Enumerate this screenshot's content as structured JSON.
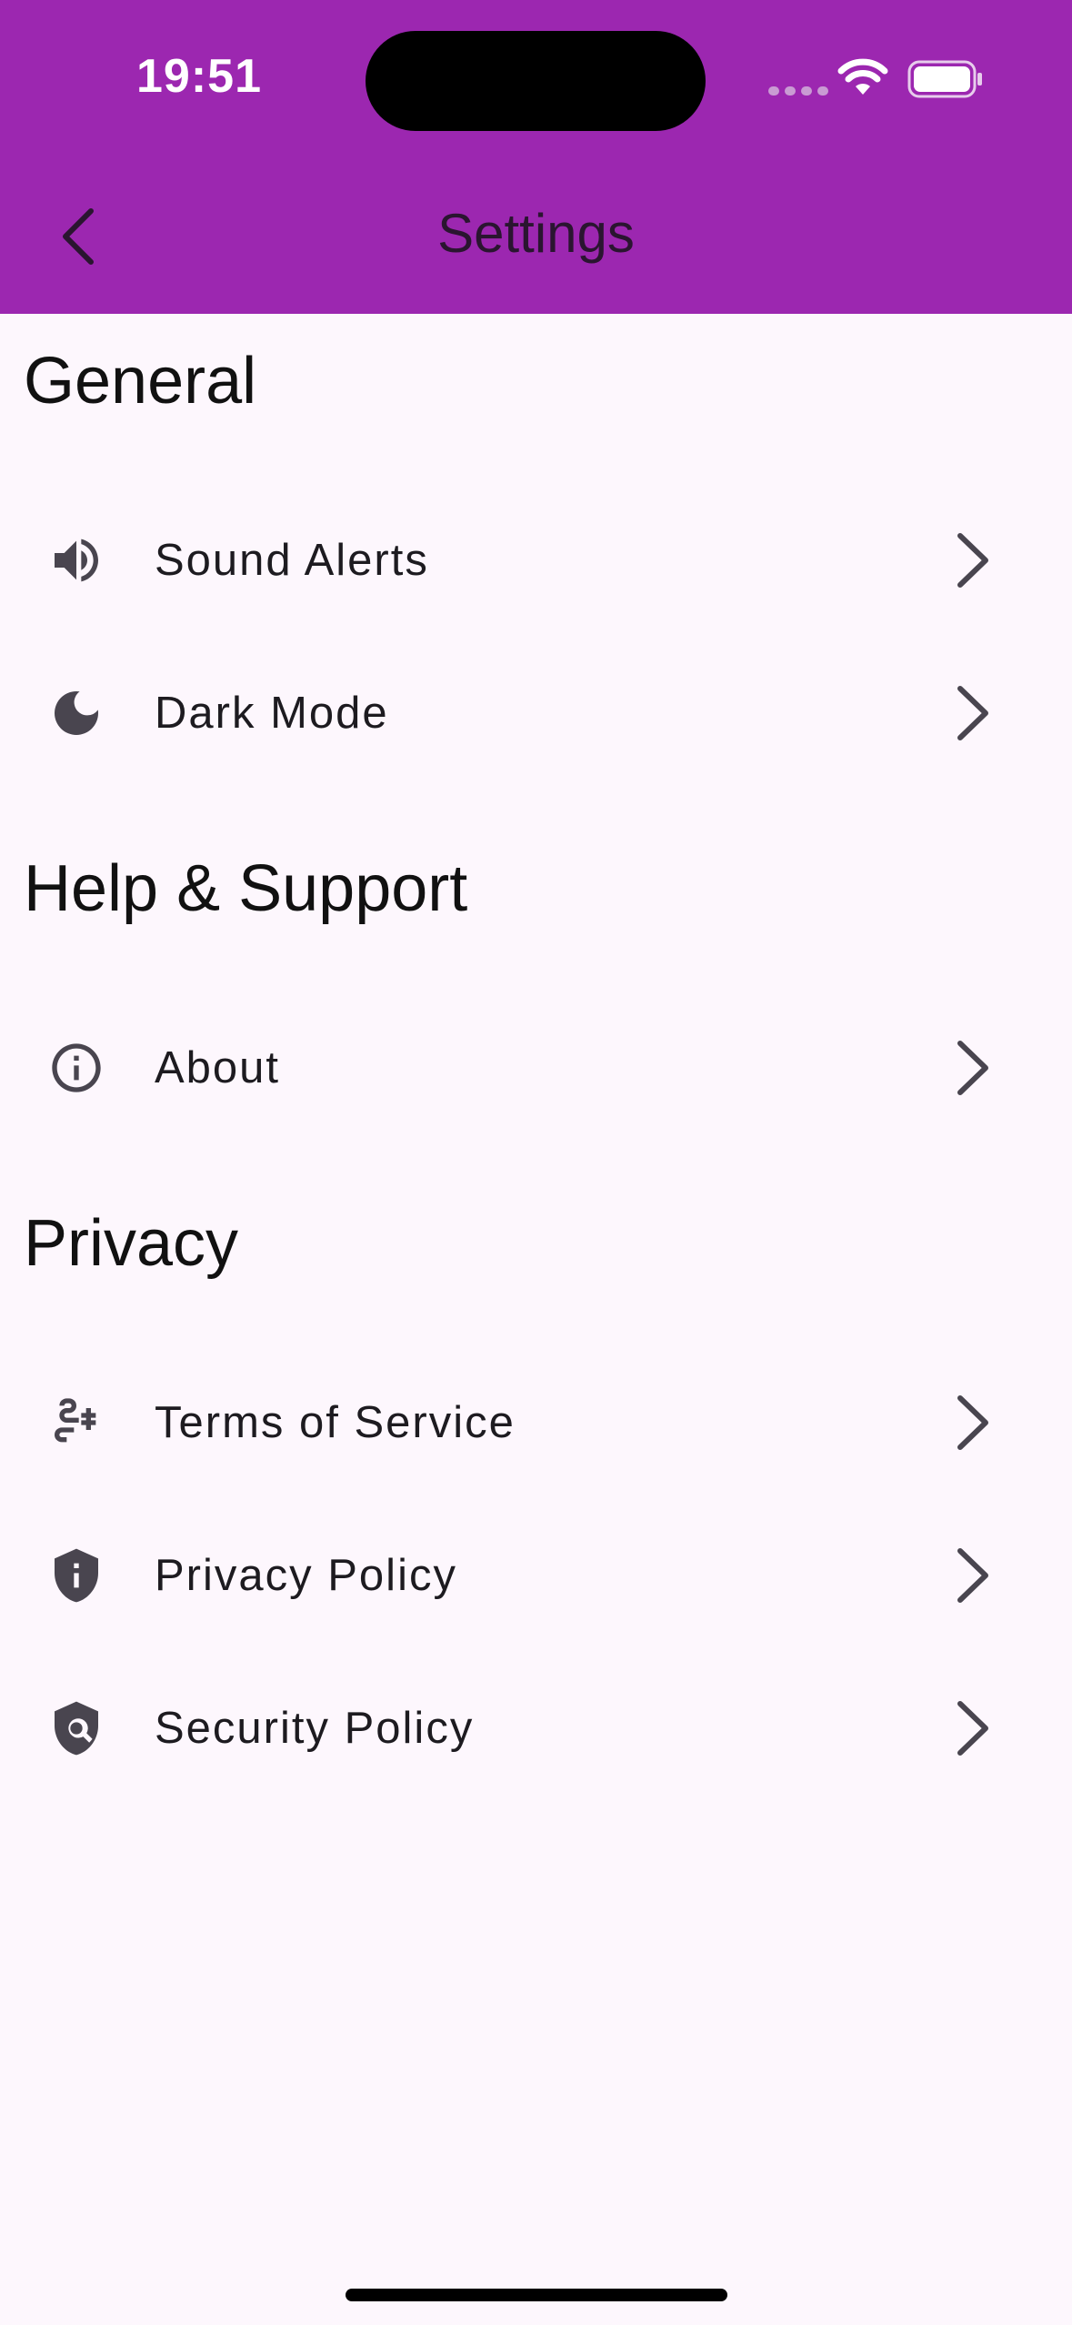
{
  "status_bar": {
    "time": "19:51"
  },
  "app_bar": {
    "title": "Settings",
    "background_color": "#9c27b0",
    "back_icon": "chevron-left-icon"
  },
  "sections": [
    {
      "title": "General",
      "items": [
        {
          "label": "Sound Alerts",
          "icon": "volume-icon"
        },
        {
          "label": "Dark Mode",
          "icon": "moon-icon"
        }
      ]
    },
    {
      "title": "Help & Support",
      "items": [
        {
          "label": "About",
          "icon": "info-icon"
        }
      ]
    },
    {
      "title": "Privacy",
      "items": [
        {
          "label": "Terms of Service",
          "icon": "plug-icon"
        },
        {
          "label": "Privacy Policy",
          "icon": "shield-info-icon"
        },
        {
          "label": "Security Policy",
          "icon": "shield-search-icon"
        }
      ]
    }
  ],
  "colors": {
    "page_background": "#fdf7fd",
    "icon": "#49454f",
    "text": "#1d1b20"
  }
}
